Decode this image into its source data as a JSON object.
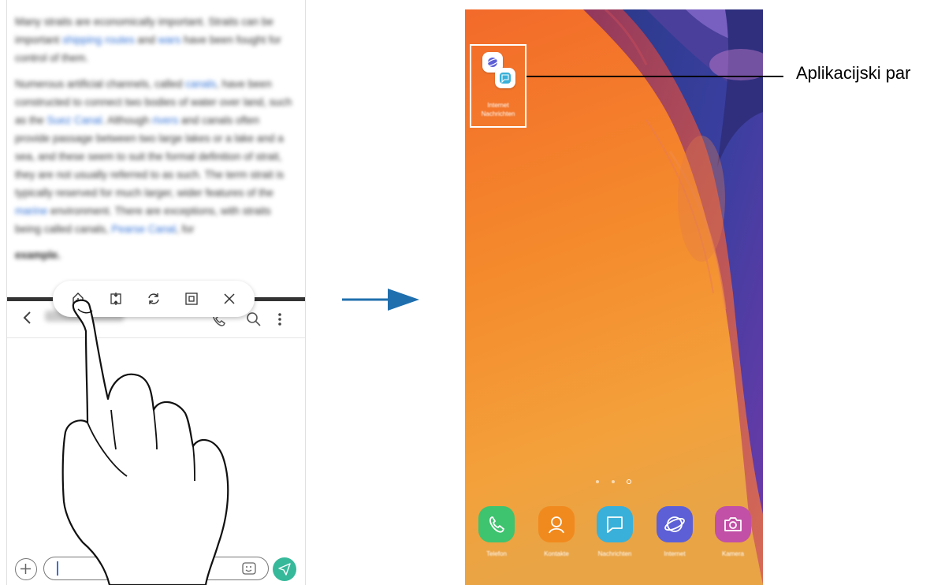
{
  "left_screen": {
    "article": {
      "para1": [
        {
          "t": "Many straits are economically important. Straits can be important "
        },
        {
          "t": "shipping routes",
          "link": true
        },
        {
          "t": " and "
        },
        {
          "t": "wars",
          "link": true
        },
        {
          "t": " have been fought for control of them."
        }
      ],
      "para2": [
        {
          "t": "Numerous artificial channels, called "
        },
        {
          "t": "canals",
          "link": true
        },
        {
          "t": ", have been constructed to connect two bodies of water over land, such as the "
        },
        {
          "t": "Suez Canal",
          "link": true
        },
        {
          "t": ". Although "
        },
        {
          "t": "rivers",
          "link": true
        },
        {
          "t": " and canals often provide passage between two large lakes or a lake and a sea, and these seem to suit the formal definition of strait, they are not usually referred to as such. The term strait is typically reserved for much larger, wider features of the "
        },
        {
          "t": "marine",
          "link": true
        },
        {
          "t": " environment. There are exceptions, with straits being called canals, "
        },
        {
          "t": "Pearse Canal",
          "link": true
        },
        {
          "t": ", for"
        }
      ],
      "last_word": "example."
    },
    "toolbar_buttons": [
      {
        "name": "add-app-pair-icon"
      },
      {
        "name": "switch-windows-icon"
      },
      {
        "name": "rotate-icon"
      },
      {
        "name": "pop-up-view-icon"
      },
      {
        "name": "close-icon"
      }
    ]
  },
  "right_screen": {
    "app_pair": {
      "label_line1": "Internet",
      "label_line2": "Nachrichten"
    },
    "dock": [
      {
        "label": "Telefon",
        "color": "#3ec36f",
        "icon": "phone-icon"
      },
      {
        "label": "Kontakte",
        "color": "#f18a1e",
        "icon": "contacts-icon"
      },
      {
        "label": "Nachrichten",
        "color": "#39b0d9",
        "icon": "messages-icon"
      },
      {
        "label": "Internet",
        "color": "#5c5fd6",
        "icon": "internet-icon"
      },
      {
        "label": "Kamera",
        "color": "#c150a6",
        "icon": "camera-icon"
      }
    ]
  },
  "callout": {
    "label": "Aplikacijski par"
  },
  "colors": {
    "accent_link": "#2f6fd6",
    "send_button": "#36b99b"
  }
}
